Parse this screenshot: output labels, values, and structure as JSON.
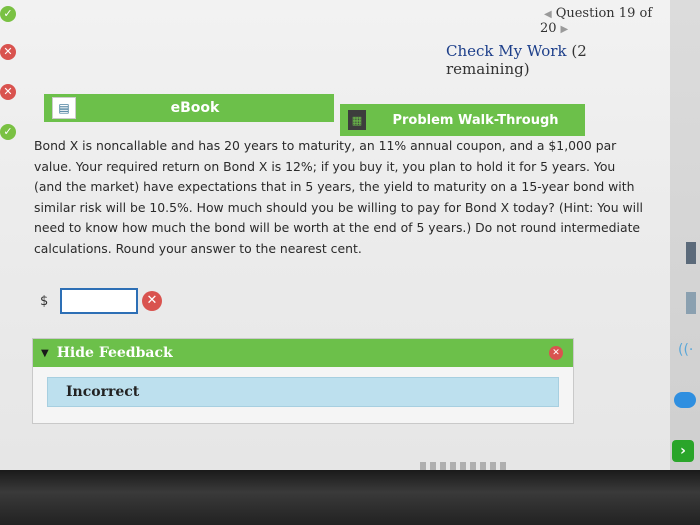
{
  "question_nav": {
    "prev_icon": "triangle-left",
    "label": "Question 19 of 20",
    "next_icon": "triangle-right"
  },
  "check_work": {
    "label": "Check My Work",
    "remaining": "(2 remaining)"
  },
  "tabs": {
    "ebook": {
      "label": "eBook",
      "icon": "book-icon"
    },
    "walkthrough": {
      "label": "Problem Walk-Through",
      "icon": "film-icon"
    }
  },
  "problem": {
    "text": "Bond X is noncallable and has 20 years to maturity, an 11% annual coupon, and a $1,000 par value. Your required return on Bond X is 12%; if you buy it, you plan to hold it for 5 years. You (and the market) have expectations that in 5 years, the yield to maturity on a 15-year bond with similar risk will be 10.5%. How much should you be willing to pay for Bond X today? (Hint: You will need to know how much the bond will be worth at the end of 5 years.) Do not round intermediate calculations. Round your answer to the nearest cent."
  },
  "answer": {
    "currency": "$",
    "value": "",
    "status_icon": "x-icon"
  },
  "feedback": {
    "toggle_label": "Hide Feedback",
    "result": "Incorrect"
  },
  "colors": {
    "green": "#6cc04a",
    "red": "#d9534f",
    "link_blue": "#1d3f8a",
    "feedback_blue": "#bde0ee"
  }
}
